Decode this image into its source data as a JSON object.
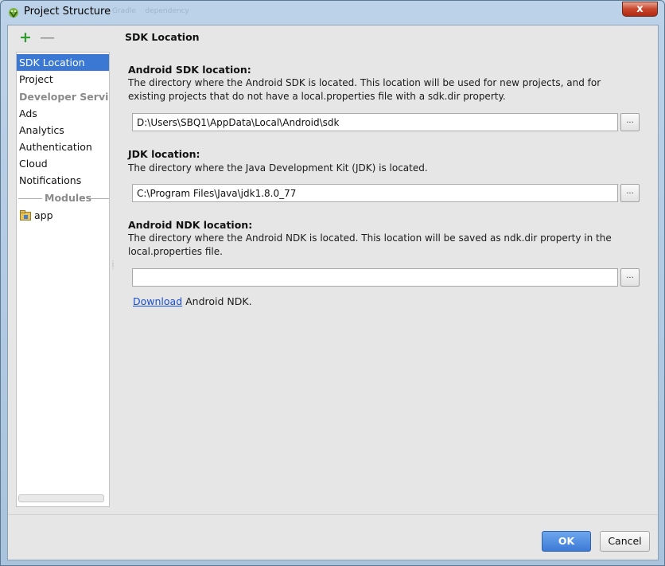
{
  "window": {
    "title": "Project Structure",
    "background_tabs": [
      "Gradle",
      "dependency"
    ],
    "close_label": "x"
  },
  "toolbar": {
    "add_icon": "plus-icon",
    "add_symbol": "+",
    "remove_icon": "minus-icon",
    "remove_symbol": "—"
  },
  "sidebar": {
    "items": [
      {
        "label": "SDK Location",
        "selected": true
      },
      {
        "label": "Project",
        "selected": false
      }
    ],
    "developer_services_header": "Developer Services",
    "services": [
      "Ads",
      "Analytics",
      "Authentication",
      "Cloud",
      "Notifications"
    ],
    "modules_header": "Modules",
    "modules": [
      {
        "label": "app",
        "icon": "module-folder-icon"
      }
    ]
  },
  "main": {
    "title": "SDK Location",
    "sdk": {
      "label": "Android SDK location:",
      "description": "The directory where the Android SDK is located. This location will be used for new projects, and for existing projects that do not have a local.properties file with a sdk.dir property.",
      "value": "D:\\Users\\SBQ1\\AppData\\Local\\Android\\sdk",
      "browse_label": "..."
    },
    "jdk": {
      "label": "JDK location:",
      "description": "The directory where the Java Development Kit (JDK) is located.",
      "value": "C:\\Program Files\\Java\\jdk1.8.0_77",
      "browse_label": "..."
    },
    "ndk": {
      "label": "Android NDK location:",
      "description": "The directory where the Android NDK is located. This location will be saved as ndk.dir property in the local.properties file.",
      "value": "",
      "browse_label": "...",
      "download_link": "Download",
      "download_suffix": " Android NDK."
    }
  },
  "buttons": {
    "ok": "OK",
    "cancel": "Cancel"
  },
  "colors": {
    "selection": "#3a78d4",
    "ok_button": "#4a86e0",
    "add_icon": "#2f9c32",
    "link": "#1a4fcf"
  }
}
